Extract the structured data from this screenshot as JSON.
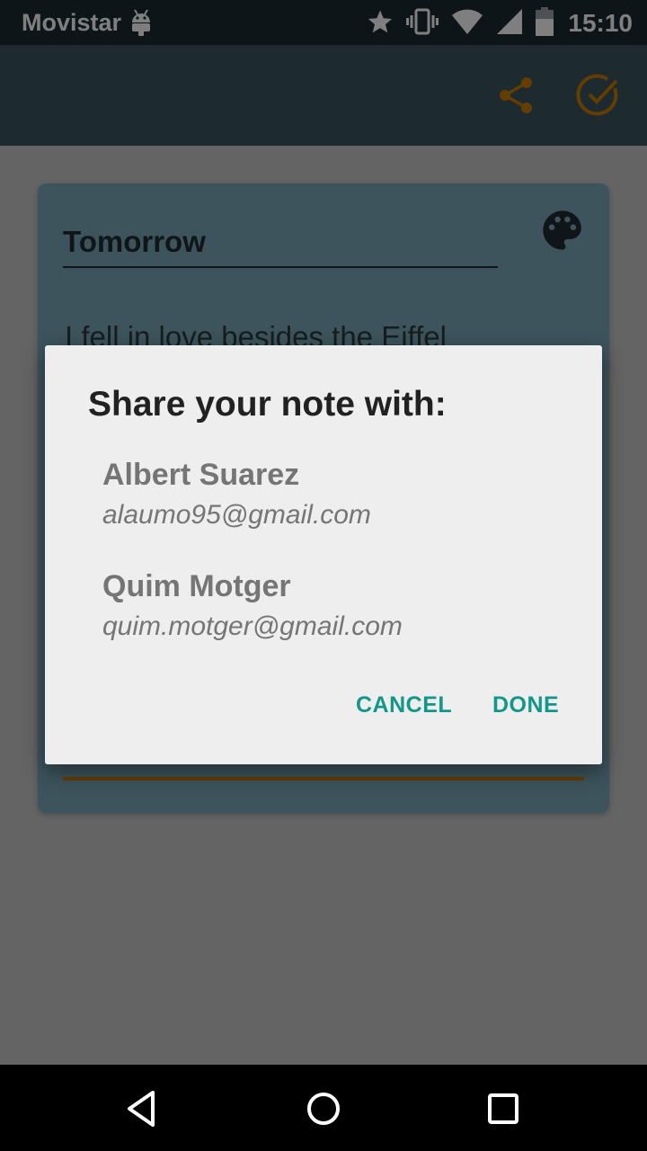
{
  "status_bar": {
    "carrier": "Movistar",
    "time": "15:10",
    "icons": [
      "android-icon",
      "star-icon",
      "vibrate-icon",
      "wifi-icon",
      "signal-icon",
      "battery-icon"
    ]
  },
  "toolbar": {
    "actions": [
      "share-icon",
      "check-circle-icon"
    ],
    "accent_color": "#c77a05"
  },
  "note": {
    "title": "Tomorrow",
    "body": "I fell in love besides the Eiffel",
    "card_color": "#7aa8b8"
  },
  "dialog": {
    "title": "Share your note with:",
    "contacts": [
      {
        "name": "Albert Suarez",
        "email": "alaumo95@gmail.com"
      },
      {
        "name": "Quim Motger",
        "email": "quim.motger@gmail.com"
      }
    ],
    "cancel_label": "CANCEL",
    "done_label": "DONE",
    "button_color": "#14978b"
  },
  "nav_bar": {
    "buttons": [
      "back-icon",
      "home-icon",
      "recents-icon"
    ]
  }
}
